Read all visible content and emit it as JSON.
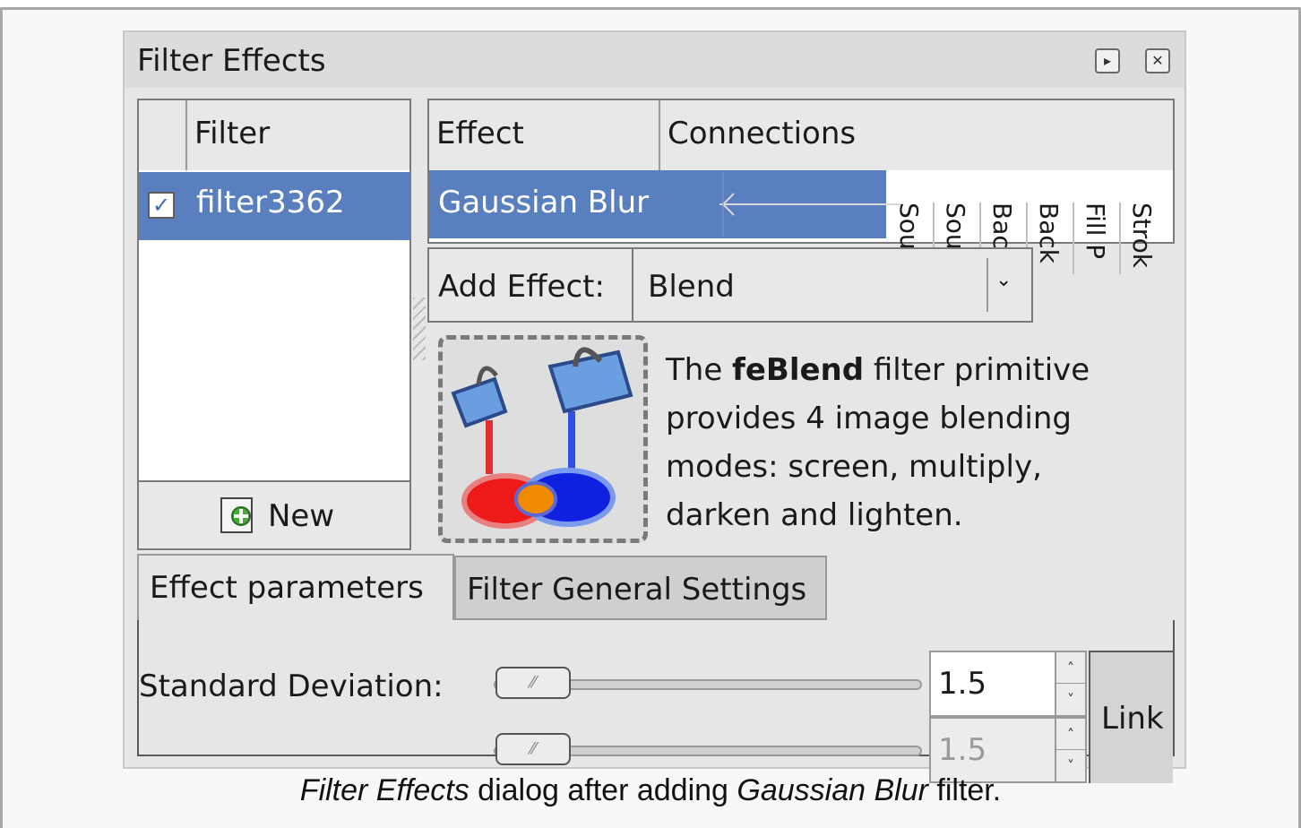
{
  "dialog": {
    "title": "Filter Effects",
    "title_btn_undock": "▸",
    "title_btn_close": "✕"
  },
  "filter_list": {
    "header_check": "",
    "header_label": "Filter",
    "rows": [
      {
        "checked": true,
        "name": "filter3362"
      }
    ],
    "new_button": "New"
  },
  "effect_list": {
    "header_effect": "Effect",
    "header_connections": "Connections",
    "rows": [
      {
        "name": "Gaussian Blur"
      }
    ],
    "inputs": [
      "Sour",
      "Sour",
      "Back",
      "Back",
      "Fill P",
      "Strok"
    ]
  },
  "add_effect": {
    "label": "Add Effect:",
    "selected": "Blend"
  },
  "description": {
    "prefix": "The ",
    "bold": "feBlend",
    "suffix": " filter primitive provides 4 image blending modes: screen, multiply, darken and lighten."
  },
  "tabs": [
    {
      "label": "Effect parameters",
      "active": true
    },
    {
      "label": "Filter General Settings",
      "active": false
    }
  ],
  "params": {
    "std_dev_label": "Standard Deviation:",
    "value_1": "1.5",
    "value_2": "1.5",
    "link_label": "Link",
    "slider_1_fraction": 0.0,
    "slider_2_fraction": 0.0
  },
  "caption": {
    "italic_1": "Filter Effects",
    "text_1": " dialog after adding ",
    "italic_2": "Gaussian Blur",
    "text_2": " filter."
  },
  "colors": {
    "selection": "#5a7fbf",
    "dialog_bg": "#e6e6e6"
  },
  "icons": {
    "undock": "play-box-icon",
    "close": "close-box-icon",
    "new": "add-document-icon",
    "dropdown": "chevron-down-icon",
    "blend_preview": "paint-buckets-blend-icon"
  }
}
